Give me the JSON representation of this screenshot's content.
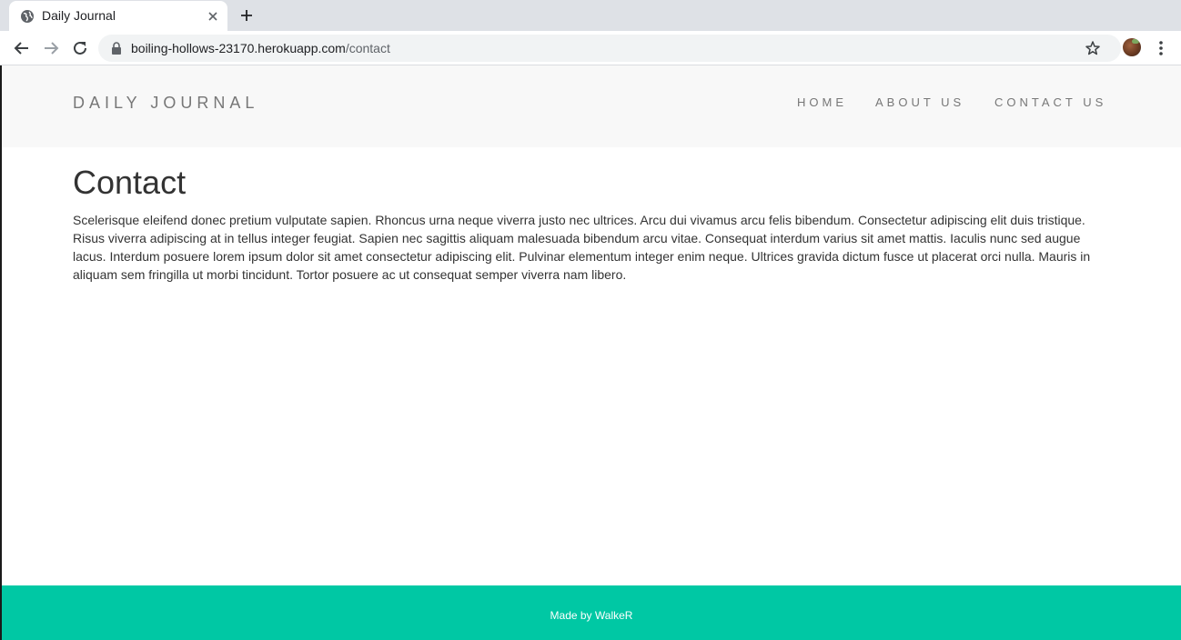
{
  "browser": {
    "tab_title": "Daily Journal",
    "url_host": "boiling-hollows-23170.herokuapp.com",
    "url_path": "/contact"
  },
  "site": {
    "brand": "DAILY JOURNAL",
    "nav": [
      {
        "label": "HOME"
      },
      {
        "label": "ABOUT US"
      },
      {
        "label": "CONTACT US"
      }
    ]
  },
  "content": {
    "title": "Contact",
    "body": "Scelerisque eleifend donec pretium vulputate sapien. Rhoncus urna neque viverra justo nec ultrices. Arcu dui vivamus arcu felis bibendum. Consectetur adipiscing elit duis tristique. Risus viverra adipiscing at in tellus integer feugiat. Sapien nec sagittis aliquam malesuada bibendum arcu vitae. Consequat interdum varius sit amet mattis. Iaculis nunc sed augue lacus. Interdum posuere lorem ipsum dolor sit amet consectetur adipiscing elit. Pulvinar elementum integer enim neque. Ultrices gravida dictum fusce ut placerat orci nulla. Mauris in aliquam sem fringilla ut morbi tincidunt. Tortor posuere ac ut consequat semper viverra nam libero."
  },
  "footer": {
    "text": "Made by WalkeR"
  },
  "colors": {
    "footer_accent": "#00c8a4",
    "navbar_bg": "#f8f8f8",
    "nav_text": "#777777"
  },
  "icons": [
    "globe-icon",
    "close-icon",
    "plus-icon",
    "back-arrow-icon",
    "forward-arrow-icon",
    "reload-icon",
    "lock-icon",
    "star-icon",
    "avatar",
    "kebab-menu-icon"
  ]
}
